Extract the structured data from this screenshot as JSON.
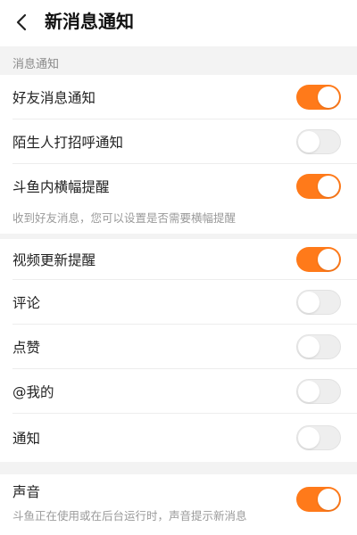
{
  "header": {
    "title": "新消息通知",
    "back_icon": "chevron-left-icon"
  },
  "section": {
    "label": "消息通知"
  },
  "items": [
    {
      "label": "好友消息通知",
      "enabled": true
    },
    {
      "label": "陌生人打招呼通知",
      "enabled": false
    },
    {
      "label": "斗鱼内横幅提醒",
      "enabled": true,
      "hint": "收到好友消息，您可以设置是否需要横幅提醒"
    },
    {
      "label": "视频更新提醒",
      "enabled": true
    },
    {
      "label": "评论",
      "enabled": false
    },
    {
      "label": "点赞",
      "enabled": false
    },
    {
      "label": "@我的",
      "enabled": false
    },
    {
      "label": "通知",
      "enabled": false
    }
  ],
  "sound": {
    "label": "声音",
    "enabled": true,
    "hint": "斗鱼正在使用或在后台运行时，声音提示新消息"
  },
  "colors": {
    "accent": "#ff7a1a",
    "toggle_off": "#eeeeee",
    "section_bg": "#f3f3f3"
  }
}
